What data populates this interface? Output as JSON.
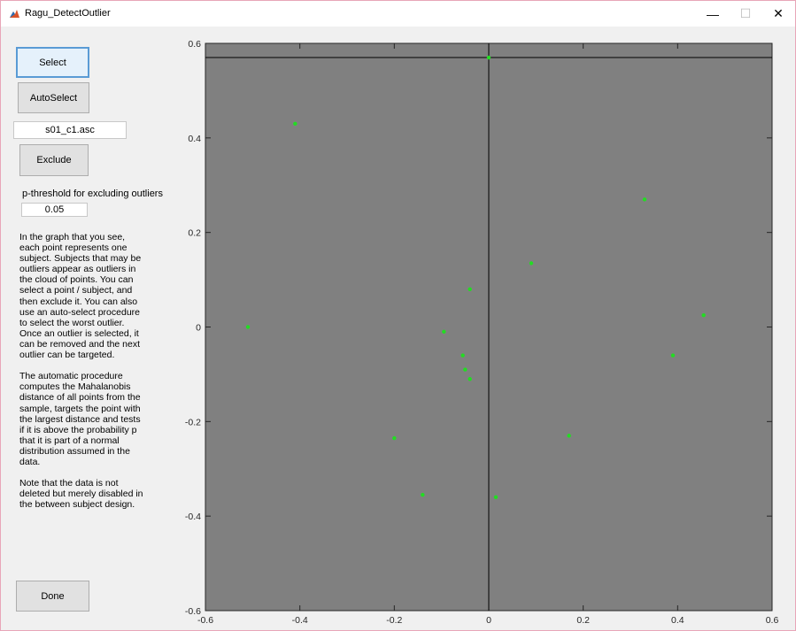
{
  "window": {
    "title": "Ragu_DetectOutlier",
    "minimize_glyph": "—",
    "maximize_glyph": "☐",
    "close_glyph": "✕",
    "app_icon": "matlab-icon"
  },
  "controls": {
    "select_label": "Select",
    "autoselect_label": "AutoSelect",
    "subject_value": "s01_c1.asc",
    "exclude_label": "Exclude",
    "threshold_label": "p-threshold for excluding outliers",
    "threshold_value": "0.05",
    "done_label": "Done"
  },
  "info": {
    "paragraph1": "In the graph that you see,\neach point represents one\nsubject. Subjects that may be\noutliers appear as outliers in\nthe cloud of points. You can\nselect a point / subject, and\nthen exclude it. You can also\nuse an auto-select procedure\nto select the worst outlier.\nOnce an outlier is selected, it\ncan be removed and the next\noutlier can be targeted.",
    "paragraph2": "The automatic procedure\ncomputes the Mahalanobis\ndistance of all points from the\nsample, targets the point with\nthe largest distance and tests\nif it is above the probability p\nthat it is part of a normal\ndistribution assumed in the\ndata.",
    "paragraph3": "Note that the data is not\ndeleted but merely disabled in\nthe between subject design."
  },
  "colors": {
    "plot_background": "#808080",
    "point_color": "#22dd22",
    "crosshair_color": "#000000"
  },
  "chart_data": {
    "type": "scatter",
    "xlim": [
      -0.6,
      0.6
    ],
    "ylim": [
      -0.6,
      0.6
    ],
    "xticks": [
      "-0.6",
      "-0.4",
      "-0.2",
      "0",
      "0.2",
      "0.4",
      "0.6"
    ],
    "yticks": [
      "0.6",
      "0.4",
      "0.2",
      "0",
      "-0.2",
      "-0.4",
      "-0.6"
    ],
    "grid": false,
    "selected_point": [
      0.0,
      0.57
    ],
    "points": [
      {
        "x": 0.0,
        "y": 0.57
      },
      {
        "x": -0.41,
        "y": 0.43
      },
      {
        "x": -0.51,
        "y": 0.0
      },
      {
        "x": -0.095,
        "y": -0.01
      },
      {
        "x": -0.04,
        "y": 0.08
      },
      {
        "x": -0.055,
        "y": -0.06
      },
      {
        "x": -0.05,
        "y": -0.09
      },
      {
        "x": -0.04,
        "y": -0.11
      },
      {
        "x": -0.2,
        "y": -0.235
      },
      {
        "x": -0.14,
        "y": -0.355
      },
      {
        "x": 0.015,
        "y": -0.36
      },
      {
        "x": 0.09,
        "y": 0.135
      },
      {
        "x": 0.17,
        "y": -0.23
      },
      {
        "x": 0.33,
        "y": 0.27
      },
      {
        "x": 0.39,
        "y": -0.06
      },
      {
        "x": 0.455,
        "y": 0.025
      }
    ]
  }
}
